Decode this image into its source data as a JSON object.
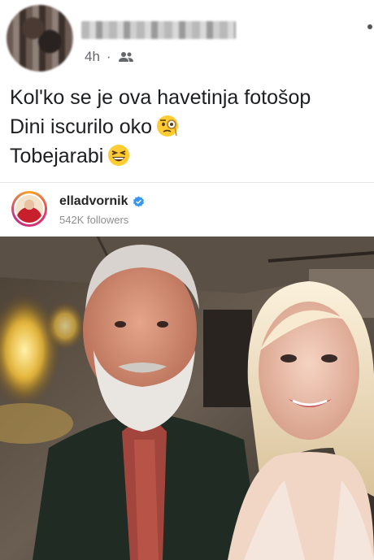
{
  "post": {
    "time": "4h",
    "separator": "·",
    "audience_icon": "friends-icon",
    "text_lines": [
      "Kol'ko se je ova havetinja fotošop",
      "Dini iscurilo oko",
      "Tobejarabi"
    ],
    "emoji_line2": "face-with-monocle-emoji",
    "emoji_line3": "grinning-squinting-face-emoji"
  },
  "instagram": {
    "username": "elladvornik",
    "followers": "542K followers",
    "verified_icon": "verified-badge-icon"
  },
  "colors": {
    "text": "#1c1e21",
    "meta": "#65676b",
    "verified": "#3897f0",
    "followers": "#8e8e8e"
  }
}
